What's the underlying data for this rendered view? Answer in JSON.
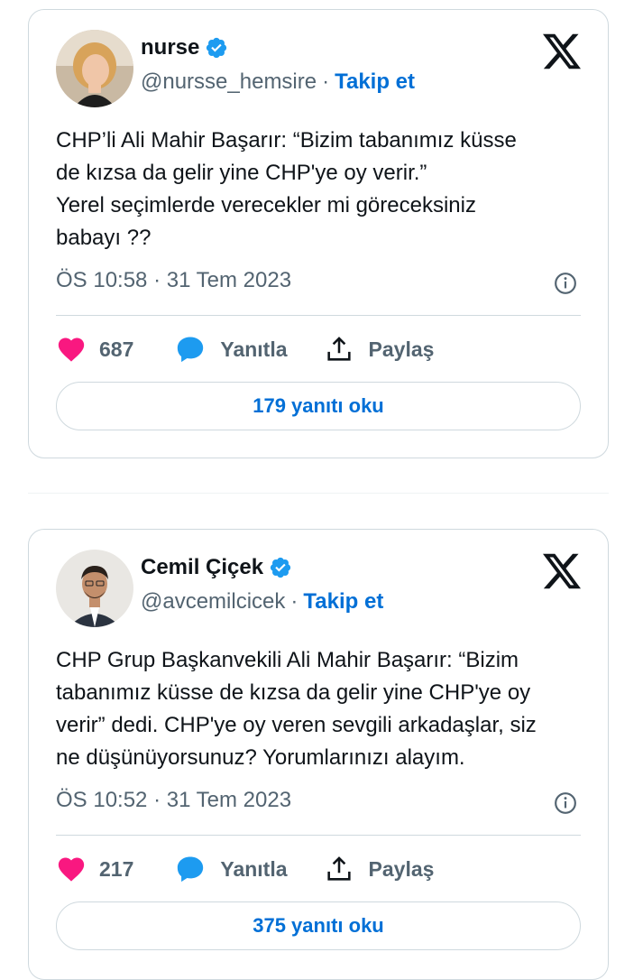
{
  "tweets": [
    {
      "name": "nurse",
      "handle": "@nursse_hemsire",
      "dot": "·",
      "follow": "Takip et",
      "text": "CHP’li Ali Mahir Başarır: “Bizim tabanımız küsse\nde kızsa da gelir yine CHP'ye oy verir.”\nYerel seçimlerde verecekler mi göreceksiniz\nbabayı ??",
      "timestamp": "ÖS 10:58 · 31 Tem 2023",
      "likes": "687",
      "reply_label": "Yanıtla",
      "share_label": "Paylaş",
      "read_replies": "179 yanıtı oku"
    },
    {
      "name": "Cemil Çiçek",
      "handle": "@avcemilcicek",
      "dot": "·",
      "follow": "Takip et",
      "text": "CHP Grup Başkanvekili Ali Mahir Başarır: “Bizim\ntabanımız küsse de kızsa da gelir yine CHP'ye oy\nverir” dedi. CHP'ye oy veren sevgili arkadaşlar, siz\nne düşünüyorsunuz? Yorumlarınızı alayım.",
      "timestamp": "ÖS 10:52 · 31 Tem 2023",
      "likes": "217",
      "reply_label": "Yanıtla",
      "share_label": "Paylaş",
      "read_replies": "375 yanıtı oku"
    }
  ],
  "colors": {
    "accent": "#006fd6",
    "verified": "#1d9bf0",
    "like": "#f91880",
    "muted": "#536471",
    "border": "#cfd9de"
  }
}
